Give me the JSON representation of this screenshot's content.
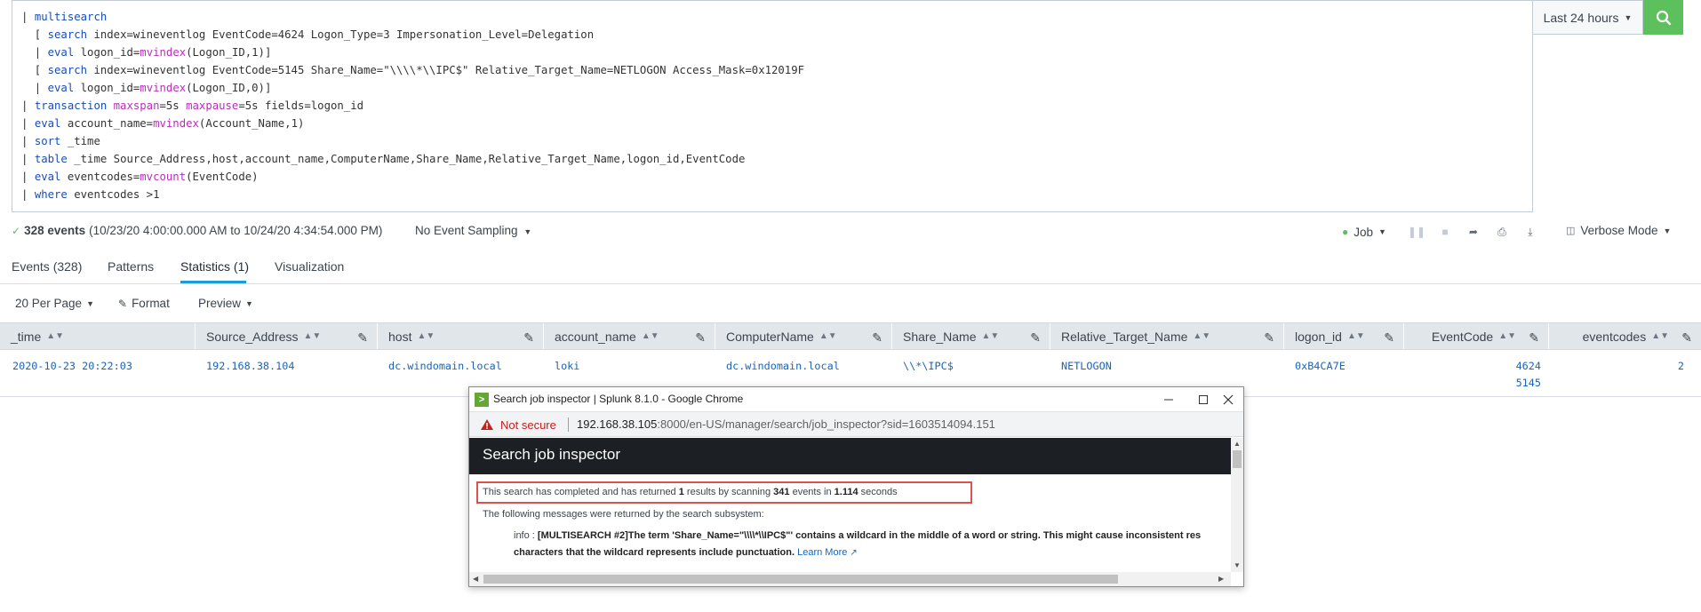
{
  "search": {
    "lines": [
      [
        {
          "t": "| ",
          "c": "pipe"
        },
        {
          "t": "multisearch",
          "c": "cmd"
        }
      ],
      [
        {
          "t": "  [ ",
          "c": "plain"
        },
        {
          "t": "search",
          "c": "cmd"
        },
        {
          "t": " index=wineventlog EventCode=4624 Logon_Type=3 Impersonation_Level=Delegation",
          "c": "plain"
        }
      ],
      [
        {
          "t": "  | ",
          "c": "plain"
        },
        {
          "t": "eval",
          "c": "cmd"
        },
        {
          "t": " logon_id=",
          "c": "plain"
        },
        {
          "t": "mvindex",
          "c": "fn"
        },
        {
          "t": "(Logon_ID,1)]",
          "c": "plain"
        }
      ],
      [
        {
          "t": "  [ ",
          "c": "plain"
        },
        {
          "t": "search",
          "c": "cmd"
        },
        {
          "t": " index=wineventlog EventCode=5145 Share_Name=\"\\\\\\\\*\\\\IPC$\" Relative_Target_Name=NETLOGON Access_Mask=0x12019F",
          "c": "plain"
        }
      ],
      [
        {
          "t": "  | ",
          "c": "plain"
        },
        {
          "t": "eval",
          "c": "cmd"
        },
        {
          "t": " logon_id=",
          "c": "plain"
        },
        {
          "t": "mvindex",
          "c": "fn"
        },
        {
          "t": "(Logon_ID,0)]",
          "c": "plain"
        }
      ],
      [
        {
          "t": "| ",
          "c": "pipe"
        },
        {
          "t": "transaction",
          "c": "cmd"
        },
        {
          "t": " ",
          "c": "plain"
        },
        {
          "t": "maxspan",
          "c": "fn"
        },
        {
          "t": "=5s ",
          "c": "plain"
        },
        {
          "t": "maxpause",
          "c": "fn"
        },
        {
          "t": "=5s fields=logon_id",
          "c": "plain"
        }
      ],
      [
        {
          "t": "| ",
          "c": "pipe"
        },
        {
          "t": "eval",
          "c": "cmd"
        },
        {
          "t": " account_name=",
          "c": "plain"
        },
        {
          "t": "mvindex",
          "c": "fn"
        },
        {
          "t": "(Account_Name,1)",
          "c": "plain"
        }
      ],
      [
        {
          "t": "| ",
          "c": "pipe"
        },
        {
          "t": "sort",
          "c": "cmd"
        },
        {
          "t": " _time",
          "c": "plain"
        }
      ],
      [
        {
          "t": "| ",
          "c": "pipe"
        },
        {
          "t": "table",
          "c": "cmd"
        },
        {
          "t": " _time Source_Address,host,account_name,ComputerName,Share_Name,Relative_Target_Name,logon_id,EventCode",
          "c": "plain"
        }
      ],
      [
        {
          "t": "| ",
          "c": "pipe"
        },
        {
          "t": "eval",
          "c": "cmd"
        },
        {
          "t": " eventcodes=",
          "c": "plain"
        },
        {
          "t": "mvcount",
          "c": "fn"
        },
        {
          "t": "(EventCode)",
          "c": "plain"
        }
      ],
      [
        {
          "t": "| ",
          "c": "pipe"
        },
        {
          "t": "where",
          "c": "cmd"
        },
        {
          "t": " eventcodes >1",
          "c": "plain"
        }
      ]
    ],
    "time_range": "Last 24 hours"
  },
  "status": {
    "events_count": "328 events",
    "range": "(10/23/20 4:00:00.000 AM to 10/24/20 4:34:54.000 PM)",
    "sampling": "No Event Sampling",
    "job_label": "Job",
    "mode": "Verbose Mode"
  },
  "tabs": [
    {
      "label": "Events (328)"
    },
    {
      "label": "Patterns"
    },
    {
      "label": "Statistics (1)"
    },
    {
      "label": "Visualization"
    }
  ],
  "options": {
    "per_page": "20 Per Page",
    "format": "Format",
    "preview": "Preview"
  },
  "table": {
    "columns": [
      "_time",
      "Source_Address",
      "host",
      "account_name",
      "ComputerName",
      "Share_Name",
      "Relative_Target_Name",
      "logon_id",
      "EventCode",
      "eventcodes"
    ],
    "row": {
      "time": "2020-10-23 20:22:03",
      "source_address": "192.168.38.104",
      "host": "dc.windomain.local",
      "account_name": "loki",
      "computer_name": "dc.windomain.local",
      "share_name": "\\\\*\\IPC$",
      "relative_target_name": "NETLOGON",
      "logon_id": "0xB4CA7E",
      "eventcode_1": "4624",
      "eventcode_2": "5145",
      "eventcodes": "2"
    }
  },
  "popup": {
    "window_title": "Search job inspector | Splunk 8.1.0 - Google Chrome",
    "not_secure": "Not secure",
    "url_host": "192.168.38.105",
    "url_rest": ":8000/en-US/manager/search/job_inspector?sid=1603514094.151",
    "header": "Search job inspector",
    "summary_pre": "This search has completed and has returned ",
    "summary_results": "1",
    "summary_mid": " results by scanning ",
    "summary_events": "341",
    "summary_mid2": " events in ",
    "summary_seconds": "1.114",
    "summary_post": " seconds",
    "messages_intro": "The following messages were returned by the search subsystem:",
    "info_prefix": "info : ",
    "info_bold": "[MULTISEARCH #2]The term 'Share_Name=\"\\\\\\\\*\\\\IPC$\"' contains a wildcard in the middle of a word or string. This might cause inconsistent res",
    "info_line2": "characters that the wildcard represents include punctuation.",
    "learn_more": "Learn More"
  },
  "colors": {
    "accent_green": "#5cc05c",
    "link_blue": "#1a64b8",
    "tab_underline": "#1a9cd8",
    "highlight_red": "#d9534f"
  }
}
